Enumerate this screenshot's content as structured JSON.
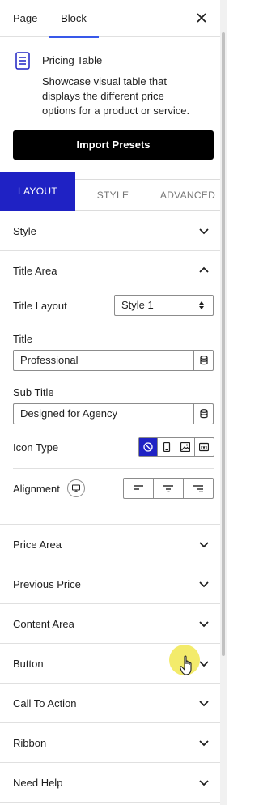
{
  "header": {
    "tabs": [
      {
        "label": "Page"
      },
      {
        "label": "Block"
      }
    ],
    "close_icon": "close-icon"
  },
  "block": {
    "icon": "pricing-table-icon",
    "name": "Pricing Table",
    "description": "Showcase visual table that displays the different price options for a product or service."
  },
  "import_button": {
    "label": "Import Presets"
  },
  "tabs": [
    {
      "label": "LAYOUT",
      "active": true
    },
    {
      "label": "STYLE"
    },
    {
      "label": "ADVANCED"
    }
  ],
  "panels": {
    "style": {
      "label": "Style"
    },
    "title_area": {
      "label": "Title Area",
      "expanded": true
    },
    "price_area": {
      "label": "Price Area"
    },
    "previous_price": {
      "label": "Previous Price"
    },
    "content_area": {
      "label": "Content Area"
    },
    "button": {
      "label": "Button"
    },
    "call_to_action": {
      "label": "Call To Action"
    },
    "ribbon": {
      "label": "Ribbon"
    },
    "need_help": {
      "label": "Need Help"
    }
  },
  "title_area": {
    "title_layout": {
      "label": "Title Layout",
      "value": "Style 1"
    },
    "title": {
      "label": "Title",
      "value": "Professional"
    },
    "sub_title": {
      "label": "Sub Title",
      "value": "Designed for Agency"
    },
    "icon_type": {
      "label": "Icon Type",
      "options": [
        "none-icon",
        "device-icon",
        "image-icon",
        "svg-icon"
      ],
      "selected": "none-icon"
    },
    "alignment": {
      "label": "Alignment",
      "options": [
        "align-left-icon",
        "align-center-icon",
        "align-right-icon"
      ]
    }
  },
  "colors": {
    "accent": "#1f22c4",
    "block_tab_underline": "#3858e9",
    "import_button_bg": "#000000"
  }
}
